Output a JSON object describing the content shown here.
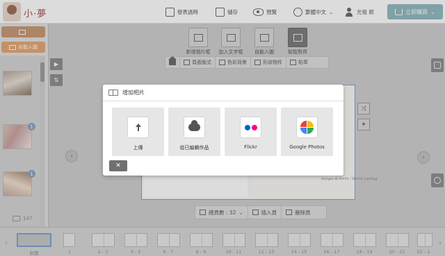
{
  "header": {
    "logo_text": "小·夢",
    "items": [
      {
        "label": "發表過時",
        "icon": "share-icon"
      },
      {
        "label": "儲存",
        "icon": "save-icon"
      },
      {
        "label": "預覽",
        "icon": "eye-icon"
      },
      {
        "label": "繁體中文",
        "icon": "globe-icon"
      },
      {
        "label": "光祖 郎",
        "icon": "user-icon"
      }
    ],
    "buy_label": "立即購買"
  },
  "sidebar": {
    "add_photo_label": "",
    "auto_fill_label": "自動入圖",
    "photo_count": "147",
    "badges": [
      "1",
      "1"
    ]
  },
  "toolbar": {
    "tools": [
      {
        "label": "新增相片框"
      },
      {
        "label": "加入文字框"
      },
      {
        "label": "自動入圖"
      },
      {
        "label": "智能對齊"
      }
    ],
    "options": [
      {
        "label": "頁面版式"
      },
      {
        "label": "色彩背景"
      },
      {
        "label": "形狀物件"
      },
      {
        "label": "貼章"
      }
    ]
  },
  "canvas": {
    "script_text": "Sungta & Forth / Worth Lasting"
  },
  "pagebar": {
    "total_label": "總頁數 : 32",
    "insert_label": "插入頁",
    "delete_label": "刪除頁"
  },
  "strip": {
    "labels": [
      "封面",
      "1",
      "2 - 3",
      "4 - 5",
      "6 - 7",
      "8 - 9",
      "10 - 11",
      "12 - 13",
      "14 - 15",
      "16 - 17",
      "18 - 19",
      "20 - 21",
      "22 - 1"
    ]
  },
  "modal": {
    "title": "增加相片",
    "options": [
      {
        "label": "上傳",
        "icon": "upload-icon"
      },
      {
        "label": "從已編輯作品",
        "icon": "cloud-icon"
      },
      {
        "label": "Flickr",
        "icon": "flickr-icon"
      },
      {
        "label": "Google Photos",
        "icon": "google-photos-icon"
      }
    ],
    "close_label": "✕"
  },
  "colors": {
    "accent_blue": "#8fb8c0",
    "side_brown": "#c7956f",
    "side_orange": "#e2a46f",
    "flickr_blue": "#0063dc",
    "flickr_pink": "#ff0084"
  }
}
